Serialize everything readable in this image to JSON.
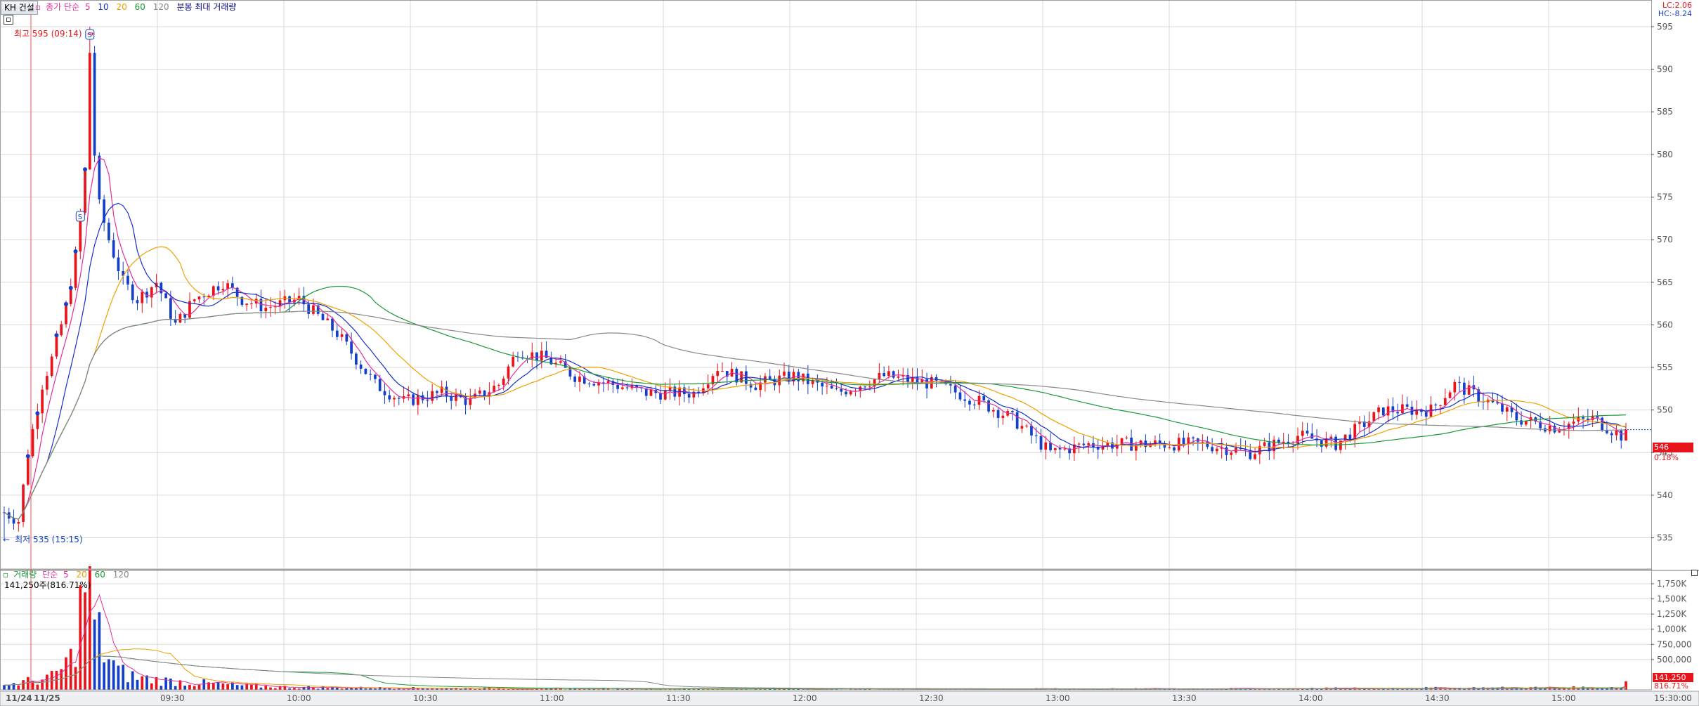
{
  "header": {
    "stock_button": "KH 건설",
    "ma_legend": {
      "title": "종가 단순",
      "periods": [
        {
          "label": "5",
          "color": "#e0309a"
        },
        {
          "label": "10",
          "color": "#1530c8"
        },
        {
          "label": "20",
          "color": "#f0a000"
        },
        {
          "label": "60",
          "color": "#1a9a3a"
        },
        {
          "label": "120",
          "color": "#888888"
        }
      ]
    },
    "bar_max_label": "분봉 최대 거래량",
    "lc_text": "LC:2.06",
    "hc_text": "HC:-8.24"
  },
  "volume_panel": {
    "title": "거래량",
    "ma_title": "단순",
    "periods": [
      {
        "label": "5",
        "color": "#e0309a"
      },
      {
        "label": "20",
        "color": "#f0a000"
      },
      {
        "label": "60",
        "color": "#1a9a3a"
      },
      {
        "label": "120",
        "color": "#888888"
      }
    ],
    "current_text": "141,250주(816.71%)",
    "current_badge": "141,250",
    "current_pct": "816.71%"
  },
  "annotations": {
    "high_label": "최고 595 (09:14)",
    "low_label": "최저 535 (15:15)",
    "price_badge": "546",
    "price_change": "0.18%"
  },
  "colors": {
    "up": "#e8141c",
    "down": "#1440c8",
    "badge": "#e8141c",
    "grid": "#d9d9d9"
  },
  "chart_data": {
    "type": "candlestick",
    "price_axis": {
      "ticks": [
        535,
        540,
        545,
        550,
        555,
        560,
        565,
        570,
        575,
        580,
        585,
        590,
        595
      ],
      "range": [
        531.5,
        597.8
      ]
    },
    "volume_axis": {
      "ticks": [
        500000,
        750000,
        1000000,
        1250000,
        1500000,
        1750000
      ],
      "tick_labels": [
        "500,000",
        "750,000",
        "1,000K",
        "1,250K",
        "1,500K",
        "1,750K"
      ],
      "range": [
        0,
        1900000
      ]
    },
    "time_axis": {
      "ticks": [
        "11/24",
        "11/25",
        "09:30",
        "10:00",
        "10:30",
        "11:00",
        "11:30",
        "12:00",
        "12:30",
        "13:00",
        "13:30",
        "14:00",
        "14:30",
        "15:00",
        "15:30:00"
      ]
    },
    "anchors": [
      [
        0,
        538
      ],
      [
        3,
        537
      ],
      [
        5,
        545
      ],
      [
        8,
        553
      ],
      [
        10,
        556
      ],
      [
        13,
        562
      ],
      [
        15,
        568
      ],
      [
        17,
        578
      ],
      [
        18,
        592
      ],
      [
        19,
        580
      ],
      [
        20,
        574
      ],
      [
        22,
        570
      ],
      [
        25,
        565
      ],
      [
        28,
        563
      ],
      [
        32,
        565
      ],
      [
        36,
        560
      ],
      [
        40,
        563
      ],
      [
        46,
        565
      ],
      [
        50,
        563
      ],
      [
        55,
        562
      ],
      [
        62,
        563
      ],
      [
        70,
        559
      ],
      [
        78,
        553
      ],
      [
        84,
        551
      ],
      [
        92,
        552
      ],
      [
        98,
        551
      ],
      [
        104,
        553
      ],
      [
        108,
        557
      ],
      [
        114,
        556
      ],
      [
        120,
        554
      ],
      [
        128,
        553
      ],
      [
        135,
        552
      ],
      [
        145,
        552
      ],
      [
        150,
        555
      ],
      [
        158,
        553
      ],
      [
        166,
        554
      ],
      [
        175,
        552
      ],
      [
        185,
        554
      ],
      [
        196,
        553
      ],
      [
        205,
        551
      ],
      [
        212,
        549
      ],
      [
        220,
        545
      ],
      [
        228,
        546
      ],
      [
        240,
        546
      ],
      [
        252,
        546
      ],
      [
        262,
        545
      ],
      [
        272,
        547
      ],
      [
        280,
        546
      ],
      [
        290,
        550
      ],
      [
        300,
        550
      ],
      [
        305,
        553
      ],
      [
        312,
        551
      ],
      [
        318,
        549
      ],
      [
        326,
        548
      ],
      [
        334,
        549
      ],
      [
        340,
        547
      ]
    ],
    "volume_anchors": [
      [
        0,
        80000
      ],
      [
        10,
        200000
      ],
      [
        14,
        500000
      ],
      [
        16,
        1300000
      ],
      [
        17,
        1800000
      ],
      [
        18,
        1500000
      ],
      [
        19,
        1100000
      ],
      [
        21,
        650000
      ],
      [
        24,
        300000
      ],
      [
        28,
        200000
      ],
      [
        34,
        150000
      ],
      [
        40,
        120000
      ],
      [
        50,
        70000
      ],
      [
        60,
        45000
      ],
      [
        70,
        35000
      ],
      [
        84,
        30000
      ],
      [
        120,
        20000
      ],
      [
        200,
        15000
      ],
      [
        260,
        20000
      ],
      [
        300,
        30000
      ],
      [
        340,
        40000
      ]
    ],
    "candle_count": 342,
    "last_volume": 141250
  }
}
